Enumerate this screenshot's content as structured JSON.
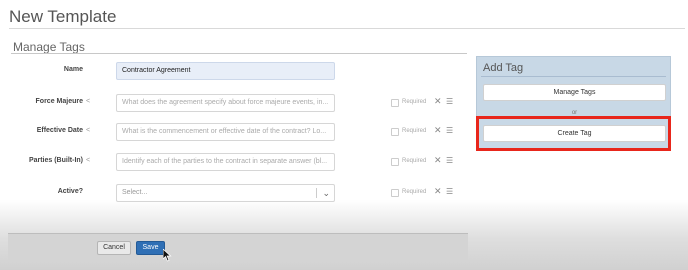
{
  "page": {
    "title": "New Template"
  },
  "section": {
    "title": "Manage Tags"
  },
  "fields": [
    {
      "label": "Name",
      "value": "Contractor Agreement"
    },
    {
      "label": "Force Majeure",
      "placeholder": "What does the agreement specify about force majeure events, in..."
    },
    {
      "label": "Effective Date",
      "placeholder": "What is the commencement or effective date of the contract? Lo..."
    },
    {
      "label": "Parties (Built-In)",
      "placeholder": "Identify each of the parties to the contract in separate answer (bl..."
    },
    {
      "label": "Active?",
      "select_value": "Select..."
    }
  ],
  "required_label": "Required",
  "add_tag_panel": {
    "title": "Add Tag",
    "manage_button": "Manage Tags",
    "or_text": "or",
    "create_button": "Create Tag"
  },
  "footer": {
    "cancel_label": "Cancel",
    "save_label": "Save"
  },
  "icons": {
    "share": "share-icon",
    "delete": "close-icon",
    "menu": "list-icon",
    "chevron": "chevron-down-icon",
    "cursor": "mouse-pointer-icon"
  },
  "colors": {
    "highlight": "#e8261b",
    "panel_bg": "#c8d8e6",
    "save_button": "#2f6fb5",
    "filled_field": "#e8eef8"
  }
}
